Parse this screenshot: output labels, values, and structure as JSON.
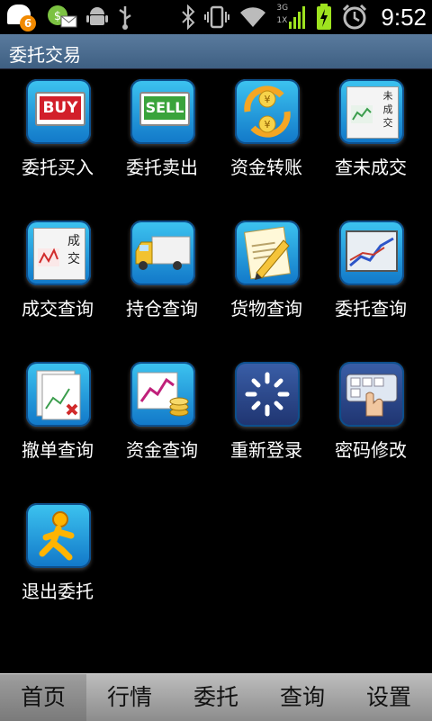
{
  "status_bar": {
    "notification_count": "6",
    "time": "9:52",
    "network_label_top": "3G",
    "network_label_bottom": "1X"
  },
  "title_bar": {
    "title": "委托交易"
  },
  "grid": {
    "items": [
      {
        "label": "委托买入",
        "icon": "buy-icon",
        "icon_text": "BUY"
      },
      {
        "label": "委托卖出",
        "icon": "sell-icon",
        "icon_text": "SELL"
      },
      {
        "label": "资金转账",
        "icon": "money-transfer-icon"
      },
      {
        "label": "查未成交",
        "icon": "pending-orders-icon",
        "icon_text": "未成交"
      },
      {
        "label": "成交查询",
        "icon": "deal-query-icon",
        "icon_text": "成交"
      },
      {
        "label": "持仓查询",
        "icon": "truck-icon"
      },
      {
        "label": "货物查询",
        "icon": "document-pencil-icon"
      },
      {
        "label": "委托查询",
        "icon": "chart-screen-icon"
      },
      {
        "label": "撤单查询",
        "icon": "cancel-order-icon"
      },
      {
        "label": "资金查询",
        "icon": "funds-chart-icon"
      },
      {
        "label": "重新登录",
        "icon": "spinner-icon"
      },
      {
        "label": "密码修改",
        "icon": "keyboard-hand-icon"
      },
      {
        "label": "退出委托",
        "icon": "exit-person-icon"
      }
    ]
  },
  "tab_bar": {
    "tabs": [
      {
        "label": "首页"
      },
      {
        "label": "行情"
      },
      {
        "label": "委托"
      },
      {
        "label": "查询"
      },
      {
        "label": "设置"
      }
    ]
  },
  "colors": {
    "background": "#000000",
    "title_bar": "#4a6b8e",
    "tile_blue": "#1a8ad6",
    "tab_bar": "#a8a8a8"
  }
}
